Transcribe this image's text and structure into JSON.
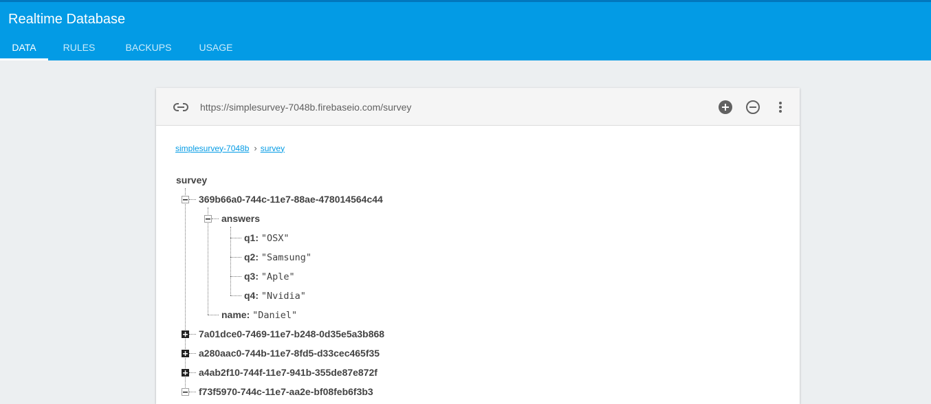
{
  "app": {
    "title": "Realtime Database",
    "brand_color": "#039be5"
  },
  "tabs": [
    {
      "label": "DATA",
      "active": true
    },
    {
      "label": "RULES",
      "active": false
    },
    {
      "label": "BACKUPS",
      "active": false
    },
    {
      "label": "USAGE",
      "active": false
    }
  ],
  "toolbar": {
    "url": "https://simplesurvey-7048b.firebaseio.com/survey",
    "icons": [
      "link-icon",
      "add-circle-icon",
      "remove-circle-icon",
      "more-vert-icon"
    ]
  },
  "breadcrumb": {
    "root": "simplesurvey-7048b",
    "current": "survey",
    "separator": "›"
  },
  "tree": {
    "root_key": "survey",
    "entries": [
      {
        "key": "369b66a0-744c-11e7-88ae-478014564c44",
        "expanded": true,
        "answers_key": "answers",
        "answers": [
          {
            "key": "q1:",
            "value": "\"OSX\""
          },
          {
            "key": "q2:",
            "value": "\"Samsung\""
          },
          {
            "key": "q3:",
            "value": "\"Aple\""
          },
          {
            "key": "q4:",
            "value": "\"Nvidia\""
          }
        ],
        "name_key": "name:",
        "name_value": "\"Daniel\""
      },
      {
        "key": "7a01dce0-7469-11e7-b248-0d35e5a3b868",
        "expanded": false
      },
      {
        "key": "a280aac0-744b-11e7-8fd5-d33cec465f35",
        "expanded": false
      },
      {
        "key": "a4ab2f10-744f-11e7-941b-355de87e872f",
        "expanded": false
      },
      {
        "key": "f73f5970-744c-11e7-aa2e-bf08feb6f3b3",
        "expanded": true
      }
    ]
  }
}
